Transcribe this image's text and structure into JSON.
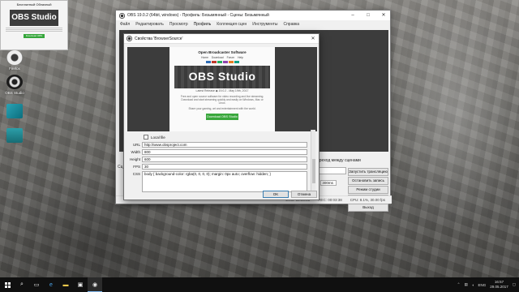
{
  "desktop": {
    "icons": [
      {
        "label": "Firefox",
        "kind": "firefox-icon"
      },
      {
        "label": "OBS Studio",
        "kind": "obs-icon"
      },
      {
        "label": "",
        "kind": "app-icon"
      },
      {
        "label": "",
        "kind": "folder-icon"
      }
    ]
  },
  "mini_browser": {
    "title": "Бесплатный Облачный",
    "logo": "OBS Studio",
    "button": "Download OBS"
  },
  "obs": {
    "title": "OBS 19.0.2 (64bit, windows) - Профиль: Безымянный - Сцены: Безымянный",
    "menu": [
      "Файл",
      "Редактировать",
      "Просмотр",
      "Профиль",
      "Коллекция сцен",
      "Инструменты",
      "Справка"
    ],
    "scene_label": "ереход между сценами",
    "transition_value": "",
    "duration_label": "ть",
    "duration_value": "300ms",
    "controls": [
      "Запустить трансляцию",
      "Остановить запись",
      "Режим студии",
      "Настройки",
      "Выход"
    ],
    "status": [
      "LIVE: 00:00:00",
      "REC: 00:03:38",
      "CPU: 8.1%, 30.00 fps"
    ],
    "left_edge_text": "Сц",
    "plus": "+"
  },
  "dialog": {
    "title": "Свойства 'BrowserSource'",
    "web": {
      "heading": "Open Broadcaster Software",
      "nav": [
        "Home",
        "Download",
        "Forum",
        "Help"
      ],
      "hero": "OBS Studio",
      "version": "Latest Release  ◆ 19.0.2 - May 19th, 2017",
      "text": "Free and open source software for video recording and live streaming. Download and start streaming quickly and easily on Windows, Mac or Linux.",
      "text2": "Share your gaming, art and entertainment with the world.",
      "download": "Download OBS Studio"
    },
    "fields": {
      "local_file_label": "Local file",
      "url_label": "URL",
      "url_value": "http://www.obsproject.com",
      "width_label": "Width",
      "width_value": "800",
      "height_label": "Height",
      "height_value": "600",
      "fps_label": "FPS",
      "fps_value": "30",
      "css_label": "CSS",
      "css_value": "body { background-color: rgba(0, 0, 0, 0); margin: 0px auto; overflow: hidden; }"
    },
    "ok": "OK",
    "cancel": "Отмена"
  },
  "taskbar": {
    "lang": "ENG",
    "time": "16:57",
    "date": "29.05.2017"
  }
}
